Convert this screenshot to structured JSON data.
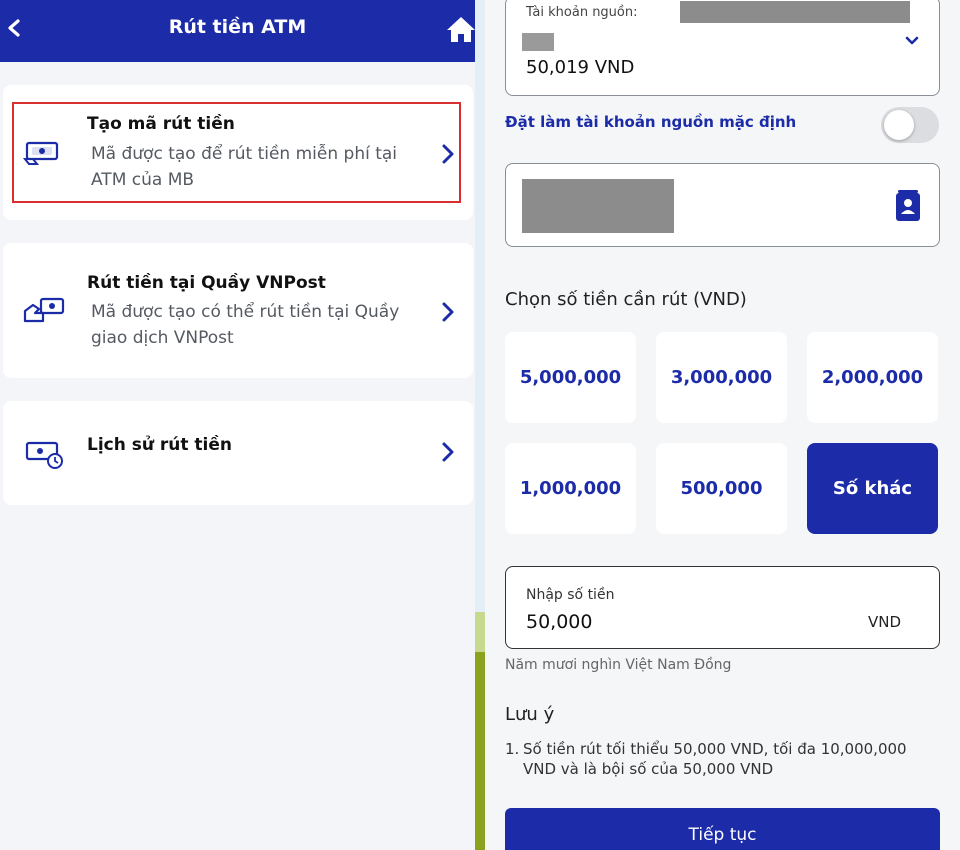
{
  "left_panel": {
    "header": {
      "title": "Rút tiền ATM"
    },
    "options": [
      {
        "title": "Tạo mã rút tiền",
        "description": "Mã được tạo để rút tiền miễn phí tại ATM của MB",
        "icon": "cash-code-icon"
      },
      {
        "title": "Rút tiền tại Quầy VNPost",
        "description": "Mã được tạo có thể rút tiền tại Quầy giao dịch VNPost",
        "icon": "hand-cash-icon"
      },
      {
        "title": "Lịch sử rút tiền",
        "description": "",
        "icon": "cash-history-icon"
      }
    ]
  },
  "right_panel": {
    "source_account": {
      "label": "Tài khoản nguồn:",
      "balance": "50,019 VND"
    },
    "default_toggle": {
      "label": "Đặt làm tài khoản nguồn mặc định",
      "enabled": false
    },
    "amount_section": {
      "title": "Chọn số tiền cần rút (VND)",
      "options": [
        "5,000,000",
        "3,000,000",
        "2,000,000",
        "1,000,000",
        "500,000",
        "Số khác"
      ],
      "selected": "Số khác"
    },
    "amount_input": {
      "label": "Nhập số tiền",
      "value": "50,000",
      "unit": "VND"
    },
    "amount_in_words": "Năm mươi nghìn Việt Nam Đồng",
    "notes": {
      "title": "Lưu ý",
      "items": [
        {
          "number": "1.",
          "text": "Số tiền rút tối thiểu 50,000 VND, tối đa 10,000,000 VND và là bội số của 50,000 VND"
        }
      ]
    },
    "continue_button": {
      "label": "Tiếp tục"
    }
  },
  "colors": {
    "brand": "#1c2ba8",
    "highlight": "#d9302f",
    "text_muted": "#555a62"
  }
}
